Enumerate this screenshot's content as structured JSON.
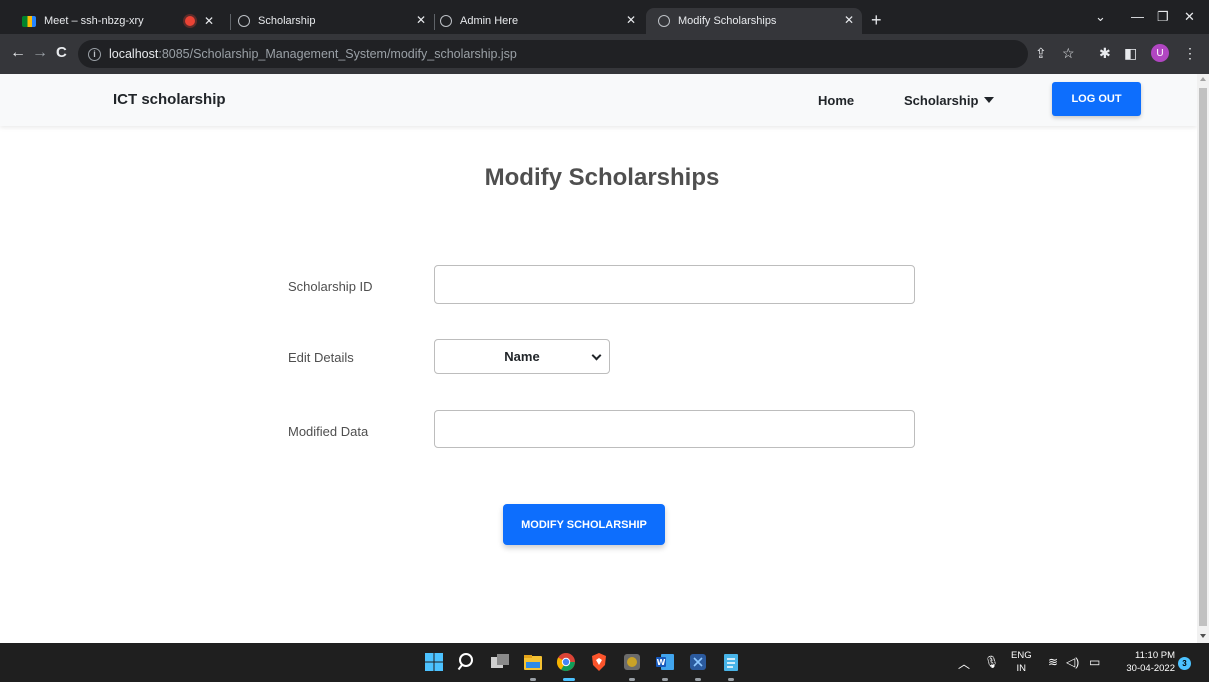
{
  "browser": {
    "tabs": [
      {
        "title": "Meet – ssh-nbzg-xry",
        "icon": "google-meet-icon"
      },
      {
        "title": "",
        "icon": "recording-icon"
      },
      {
        "title": "Scholarship",
        "icon": "globe-icon"
      },
      {
        "title": "Admin Here",
        "icon": "globe-icon"
      },
      {
        "title": "Modify Scholarships",
        "icon": "globe-icon",
        "active": true
      }
    ],
    "url_host": "localhost",
    "url_rest": ":8085/Scholarship_Management_System/modify_scholarship.jsp",
    "profile_initial": "U"
  },
  "navbar": {
    "brand": "ICT scholarship",
    "home": "Home",
    "scholarship": "Scholarship",
    "logout": "LOG OUT"
  },
  "form": {
    "title": "Modify Scholarships",
    "scholarship_id_label": "Scholarship ID",
    "scholarship_id_value": "",
    "edit_details_label": "Edit Details",
    "edit_details_selected": "Name",
    "modified_data_label": "Modified Data",
    "modified_data_value": "",
    "submit": "MODIFY SCHOLARSHIP"
  },
  "taskbar": {
    "lang_line1": "ENG",
    "lang_line2": "IN",
    "time": "11:10 PM",
    "date": "30-04-2022",
    "notification_count": "3"
  },
  "colors": {
    "accent": "#0d6efd",
    "navbar_bg": "#f8f9fa",
    "browser_dark": "#202124"
  }
}
